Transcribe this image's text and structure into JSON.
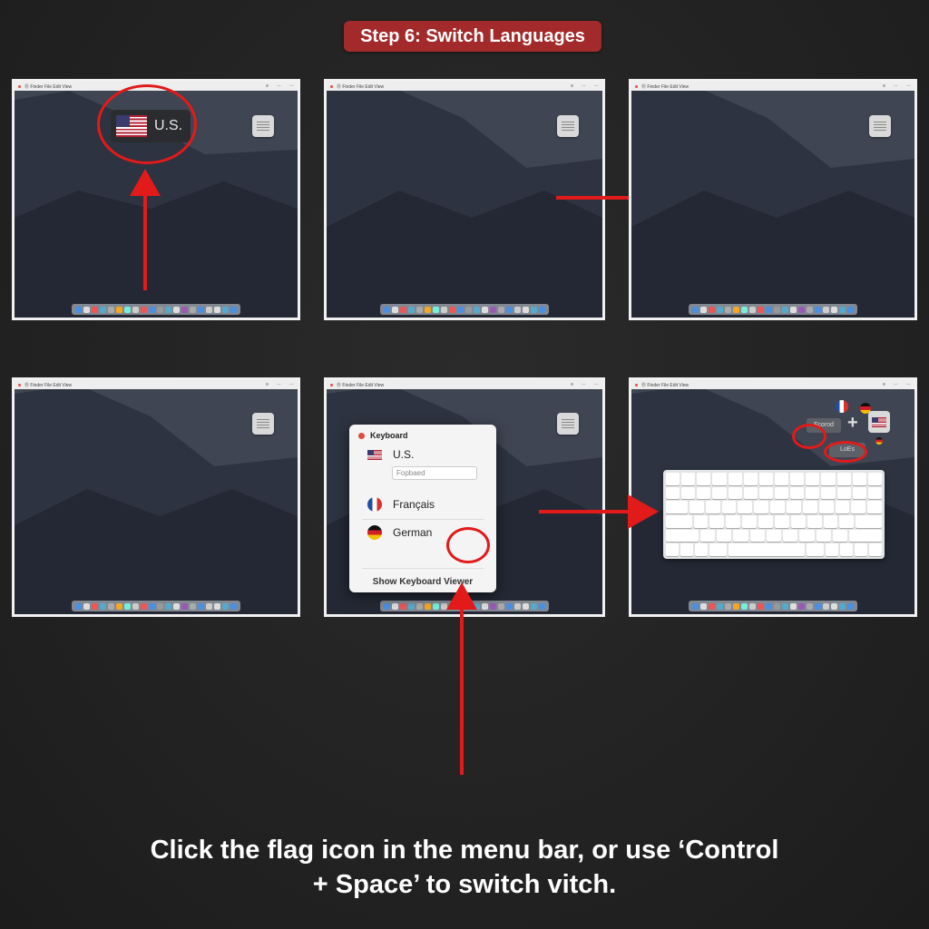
{
  "step_title": "Step 6: Switch Languages",
  "panel1": {
    "input_label": "U.S."
  },
  "popup": {
    "title": "Keyboard",
    "items": [
      {
        "label": "U.S.",
        "flag": "us-flag"
      },
      {
        "label": "Français",
        "flag": "france-flag"
      },
      {
        "label": "German",
        "flag": "germany-flag"
      }
    ],
    "field_placeholder": "Fopbaed",
    "footer": "Show Keyboard Viewer"
  },
  "panel6": {
    "pill_left": "Fcorod",
    "pill_bottom": "LoEs",
    "plus": "+"
  },
  "caption": {
    "line1": "Click the flag icon in the menu bar, or use ‘Control",
    "line2": "+ Space’ to switch vitch."
  },
  "colors": {
    "accent_red": "#e21a1a",
    "badge_bg": "#a32a2a",
    "panel_border": "#f1f1f1"
  }
}
